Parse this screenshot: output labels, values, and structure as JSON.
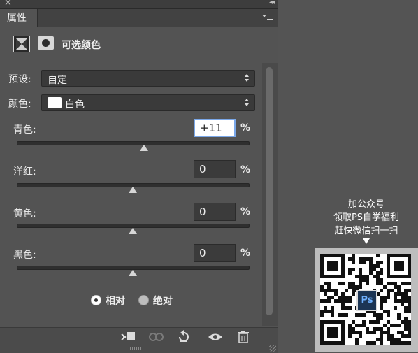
{
  "window": {
    "close_glyph": "✕",
    "collapse_glyph": "◂◂"
  },
  "panel": {
    "tab_label": "属性",
    "header_title": "可选颜色",
    "preset_label": "预设:",
    "preset_value": "自定",
    "color_label": "颜色:",
    "color_value": "白色",
    "color_swatch": "#ffffff",
    "sliders": [
      {
        "label": "青色:",
        "value": "+11",
        "unit": "%",
        "position": 0.55,
        "focused": true
      },
      {
        "label": "洋红:",
        "value": "0",
        "unit": "%",
        "position": 0.5,
        "focused": false
      },
      {
        "label": "黄色:",
        "value": "0",
        "unit": "%",
        "position": 0.5,
        "focused": false
      },
      {
        "label": "黑色:",
        "value": "0",
        "unit": "%",
        "position": 0.5,
        "focused": false
      }
    ],
    "method": {
      "relative": "相对",
      "absolute": "绝对",
      "selected": "relative"
    }
  },
  "promo": {
    "lines": [
      "加公众号",
      "领取PS自学福利",
      "赶快微信扫一扫"
    ],
    "logo_text": "Ps"
  },
  "colors": {
    "accent": "#7aa7e8",
    "panel_bg": "#535353"
  }
}
